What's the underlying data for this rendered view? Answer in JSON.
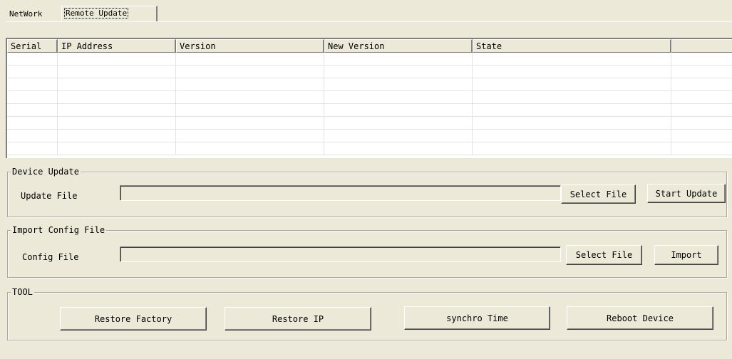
{
  "tabs": [
    {
      "label": "NetWork",
      "active": false
    },
    {
      "label": "Remote Update",
      "active": true
    }
  ],
  "device_table": {
    "columns": [
      "Serial",
      "IP Address",
      "Version",
      "New Version",
      "State",
      ""
    ],
    "rows": [
      [
        "",
        "",
        "",
        "",
        "",
        ""
      ],
      [
        "",
        "",
        "",
        "",
        "",
        ""
      ],
      [
        "",
        "",
        "",
        "",
        "",
        ""
      ],
      [
        "",
        "",
        "",
        "",
        "",
        ""
      ],
      [
        "",
        "",
        "",
        "",
        "",
        ""
      ],
      [
        "",
        "",
        "",
        "",
        "",
        ""
      ],
      [
        "",
        "",
        "",
        "",
        "",
        ""
      ],
      [
        "",
        "",
        "",
        "",
        "",
        ""
      ]
    ]
  },
  "device_update": {
    "legend": "Device Update",
    "file_label": "Update File",
    "file_value": "",
    "select_label": "Select File",
    "start_label": "Start Update"
  },
  "import_config": {
    "legend": "Import Config File",
    "file_label": "Config File",
    "file_value": "",
    "select_label": "Select File",
    "import_label": "Import"
  },
  "tool": {
    "legend": "TOOL",
    "restore_factory_label": "Restore Factory",
    "restore_ip_label": "Restore IP",
    "synchro_time_label": "synchro Time",
    "reboot_label": "Reboot Device"
  },
  "colors": {
    "window_bg": "#ece9d8",
    "table_bg": "#ffffff",
    "grid_line": "#e3e3e3"
  }
}
